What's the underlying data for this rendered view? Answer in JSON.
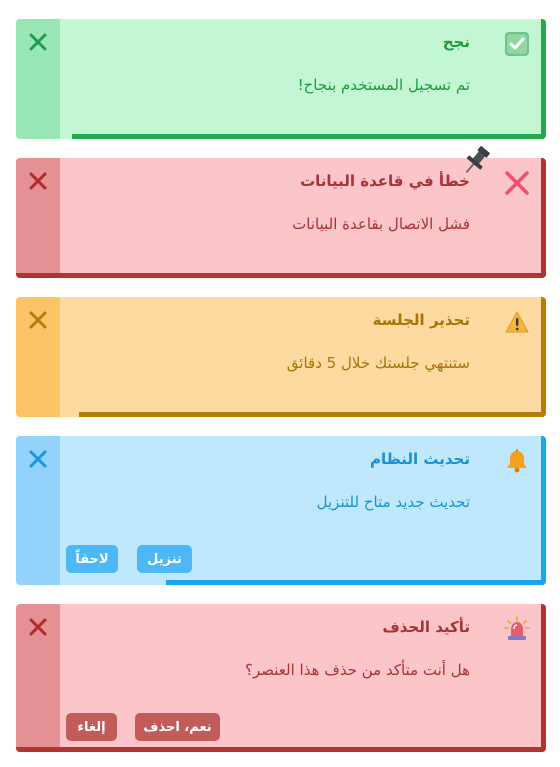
{
  "toasts": [
    {
      "type": "success",
      "title": "نجح",
      "message": "تم تسجيل المستخدم بنجاح!",
      "icon": "checkmark-icon",
      "color": "#21a94d"
    },
    {
      "type": "error",
      "title": "خطأ في قاعدة البيانات",
      "message": "فشل الاتصال بقاعدة البيانات",
      "icon": "cross-mark-icon",
      "color": "#b3332f",
      "pinned": true
    },
    {
      "type": "warning",
      "title": "تحذير الجلسة",
      "message": "ستنتهي جلستك خلال 5 دقائق",
      "icon": "warning-icon",
      "color": "#b47e0b"
    },
    {
      "type": "info",
      "title": "تحديث النظام",
      "message": "تحديث جديد متاح للتنزيل",
      "icon": "bell-icon",
      "color": "#1ba7ef",
      "actions": {
        "primary": "تنزيل",
        "secondary": "لاحقاً"
      }
    },
    {
      "type": "confirm",
      "title": "تأكيد الحذف",
      "message": "هل أنت متأكد من حذف هذا العنصر؟",
      "icon": "siren-icon",
      "color": "#b3332f",
      "actions": {
        "primary": "نعم، احذف",
        "secondary": "إلغاء"
      }
    }
  ]
}
